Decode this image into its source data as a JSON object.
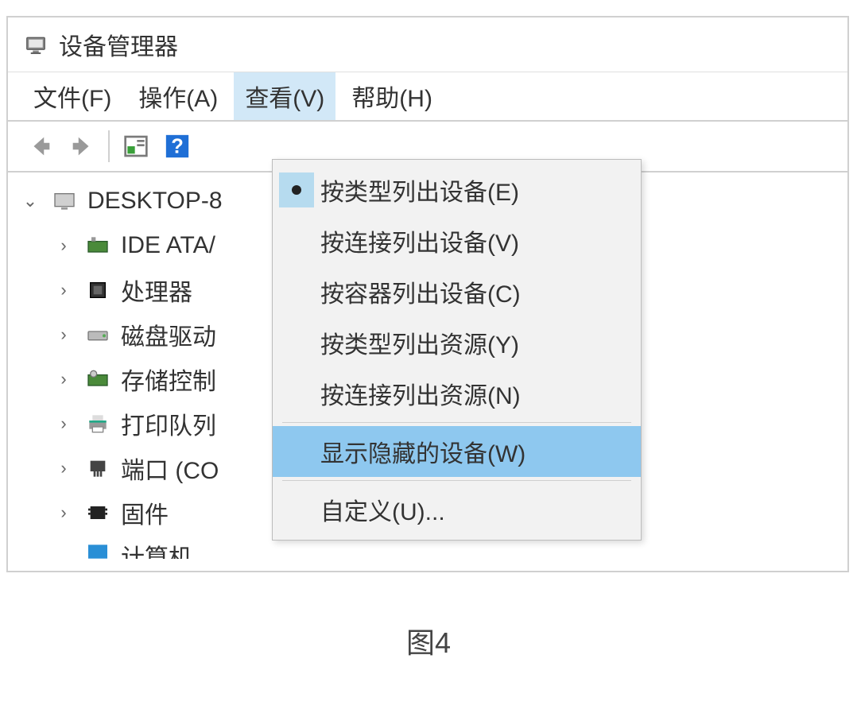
{
  "window": {
    "title": "设备管理器"
  },
  "menubar": {
    "file": "文件(F)",
    "action": "操作(A)",
    "view": "查看(V)",
    "help": "帮助(H)"
  },
  "tree": {
    "root": "DESKTOP-8",
    "children": [
      {
        "label": "IDE ATA/"
      },
      {
        "label": "处理器"
      },
      {
        "label": "磁盘驱动"
      },
      {
        "label": "存储控制"
      },
      {
        "label": "打印队列"
      },
      {
        "label": "端口 (CO"
      },
      {
        "label": "固件"
      },
      {
        "label": "计算机"
      }
    ]
  },
  "viewMenu": {
    "byType": "按类型列出设备(E)",
    "byConnection": "按连接列出设备(V)",
    "byContainer": "按容器列出设备(C)",
    "resByType": "按类型列出资源(Y)",
    "resByConnection": "按连接列出资源(N)",
    "showHidden": "显示隐藏的设备(W)",
    "customize": "自定义(U)..."
  },
  "caption": "图4"
}
